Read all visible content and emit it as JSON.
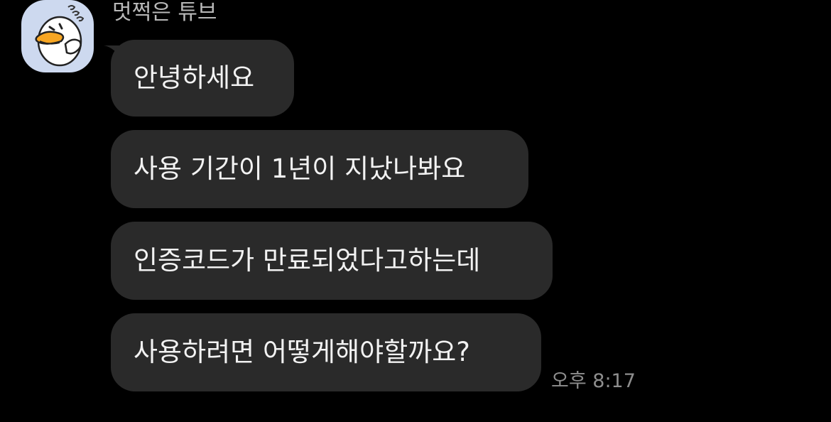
{
  "chat": {
    "sender": {
      "name": "멋쩍은 튜브",
      "avatar_icon": "tube-duck-avatar-icon",
      "avatar_bg": "#cdd9ef"
    },
    "messages": [
      {
        "text": "안녕하세요"
      },
      {
        "text": "사용 기간이 1년이 지났나봐요"
      },
      {
        "text": "인증코드가 만료되었다고하는데"
      },
      {
        "text": "사용하려면 어떻게해야할까요?"
      }
    ],
    "timestamp": "오후 8:17",
    "colors": {
      "background": "#000000",
      "bubble": "#2a2a2a",
      "text": "#f2f2f2",
      "muted": "#8e8e8e"
    }
  }
}
